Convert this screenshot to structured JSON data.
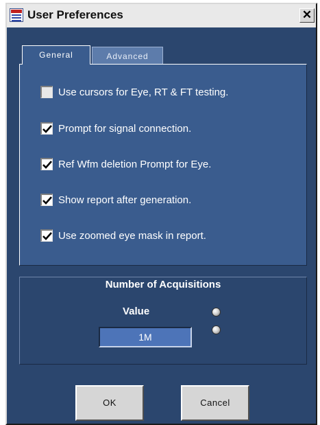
{
  "window": {
    "title": "User Preferences",
    "close_glyph": "✕"
  },
  "tabs": [
    {
      "label": "General",
      "selected": true
    },
    {
      "label": "Advanced",
      "selected": false
    }
  ],
  "options": [
    {
      "label": "Use cursors for Eye, RT & FT testing.",
      "checked": false
    },
    {
      "label": "Prompt for signal connection.",
      "checked": true
    },
    {
      "label": "Ref Wfm deletion Prompt for Eye.",
      "checked": true
    },
    {
      "label": "Show report after generation.",
      "checked": true
    },
    {
      "label": "Use zoomed eye mask in report.",
      "checked": true
    }
  ],
  "acquisitions": {
    "title": "Number of Acquisitions",
    "value_label": "Value",
    "value": "1M"
  },
  "buttons": {
    "ok": "OK",
    "cancel": "Cancel"
  },
  "colors": {
    "dialog_bg": "#2b466e",
    "panel_bg": "#3a5c8e",
    "value_field_bg": "#4d74b8"
  }
}
